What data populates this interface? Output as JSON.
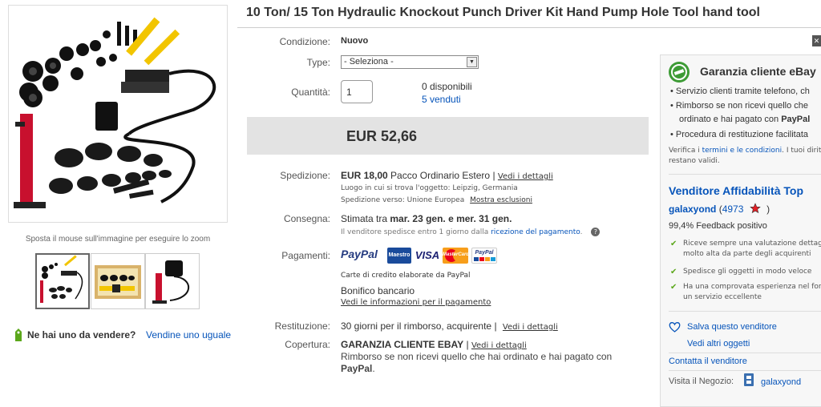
{
  "title": "10 Ton/ 15 Ton Hydraulic Knockout Punch Driver Kit Hand Pump Hole Tool hand tool",
  "gallery": {
    "zoom_hint": "Sposta il mouse sull'immagine per eseguire lo zoom",
    "thumbnail_count": 3
  },
  "sell": {
    "question": "Ne hai uno da vendere?",
    "link": "Vendine uno uguale"
  },
  "form": {
    "condition_label": "Condizione:",
    "condition_value": "Nuovo",
    "type_label": "Type:",
    "type_value": "- Seleziona -",
    "quantity_label": "Quantità:",
    "quantity_value": "1",
    "available": "0 disponibili",
    "sold": "5 venduti"
  },
  "price": "EUR 52,66",
  "shipping": {
    "label": "Spedizione:",
    "cost": "EUR 18,00",
    "service": "Pacco Ordinario Estero",
    "separator": "|",
    "details_link": "Vedi i dettagli",
    "location": "Luogo in cui si trova l'oggetto:  Leipzig, Germania",
    "ships_to": "Spedizione verso:  Unione Europea",
    "exclusions_link": "Mostra esclusioni"
  },
  "delivery": {
    "label": "Consegna:",
    "prefix": "Stimata tra",
    "dates": "mar. 23 gen. e mer. 31 gen.",
    "note": "Il venditore spedisce entro 1 giorno dalla",
    "note_link": "ricezione del pagamento",
    "note_end": ".",
    "help": "?"
  },
  "payments": {
    "label": "Pagamenti:",
    "paypal": "PayPal",
    "maestro": "Maestro",
    "visa": "VISA",
    "mastercard": "MasterCard",
    "paypal_badge": "PayPal",
    "card_note": "Carte di credito elaborate da PayPal",
    "bank": "Bonifico bancario",
    "details_link": "Vedi le informazioni per il pagamento"
  },
  "returns": {
    "label": "Restituzione:",
    "text": "30 giorni per il rimborso, acquirente",
    "separator": "|",
    "details_link": "Vedi i dettagli"
  },
  "coverage": {
    "label": "Copertura:",
    "title": "GARANZIA CLIENTE EBAY",
    "separator": "|",
    "details_link": "Vedi i dettagli",
    "text": "Rimborso se non ricevi quello che hai ordinato e hai pagato con",
    "paypal": "PayPal",
    "period": "."
  },
  "guarantee": {
    "title": "Garanzia cliente eBay",
    "bullets": [
      "Servizio clienti tramite telefono, ch",
      "Rimborso se non ricevi quello che",
      "Procedura di restituzione facilitata"
    ],
    "bullet2_line2_prefix": "ordinato e hai pagato con ",
    "bullet2_line2_bold": "PayPal",
    "verify_prefix": "Verifica i ",
    "verify_link": "termini e le condizioni",
    "verify_suffix": ". I tuoi diritti d",
    "verify_line2": "restano validi."
  },
  "seller": {
    "top_rated": "Venditore Affidabilità Top",
    "name": "galaxyond",
    "score_open": "(",
    "score": "4973",
    "score_close": ")",
    "feedback": "99,4% Feedback positivo",
    "points": [
      {
        "l1": "Riceve sempre una valutazione dettaglia",
        "l2": "molto alta da parte degli acquirenti"
      },
      {
        "l1": "Spedisce gli oggetti in modo veloce",
        "l2": ""
      },
      {
        "l1": "Ha una comprovata esperienza nel fornir",
        "l2": "un servizio eccellente"
      }
    ],
    "save_link": "Salva questo venditore",
    "items_link": "Vedi altri oggetti",
    "contact_link": "Contatta il venditore",
    "store_label": "Visita il Negozio:",
    "store_name": "galaxyond"
  },
  "colors": {
    "link": "#0654ba",
    "price_bg": "#e3e3e3",
    "paypal_dark": "#253b80",
    "paypal_light": "#179bd7",
    "check": "#5ba71b",
    "guarantee_green": "#3d9b35"
  }
}
